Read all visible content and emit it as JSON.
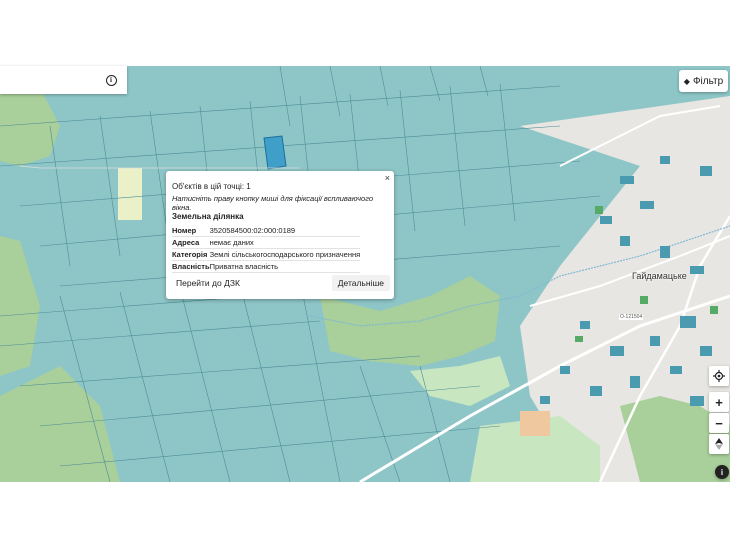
{
  "search": {
    "value": "",
    "placeholder": ""
  },
  "filter": {
    "label": "Фільтр"
  },
  "popup": {
    "objects_count": "Об'єктів в цій точці: 1",
    "hint": "Натисніть праву кнопку миші для фіксації вспливаючого вікна.",
    "close_glyph": "×",
    "section_title": "Земельна ділянка",
    "rows": [
      {
        "key": "Номер",
        "value": "3520584500:02:000:0189"
      },
      {
        "key": "Адреса",
        "value": "немає даних"
      },
      {
        "key": "Категорія",
        "value": "Землі сільськогосподарського призначення"
      },
      {
        "key": "Власність",
        "value": "Приватна власність"
      }
    ],
    "button_dzk": "Перейти до ДЗК",
    "button_details": "Детальніше"
  },
  "map": {
    "place_label": "Гайдамацьке",
    "road_label": "О-121504",
    "colors": {
      "parcel": "#8ec6c8",
      "parcel_line": "#4d8d97",
      "selected": "#3f9fc8",
      "forest": "#a9cf9a",
      "meadow": "#c8e6c0",
      "village": "#e8e6e2",
      "road": "#ffffff",
      "building": "#4a9ab0"
    }
  },
  "controls": {
    "locate_icon": "locate-icon",
    "zoom_in": "+",
    "zoom_out": "−",
    "compass": "compass-icon",
    "attribution": "i"
  }
}
